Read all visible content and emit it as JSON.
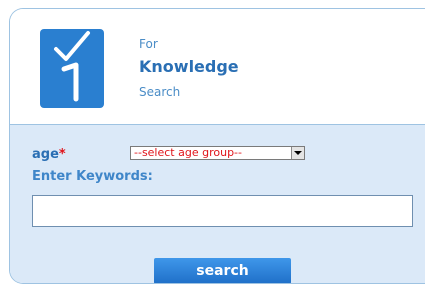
{
  "brand": {
    "logo_icon": "check-one-icon",
    "line1": "For",
    "line2": "Knowledge",
    "line3": "Search"
  },
  "form": {
    "age_label": "age",
    "required_mark": "*",
    "age_select_value": "--select age group--",
    "keywords_label": "Enter Keywords:",
    "keywords_value": "",
    "search_label": "search"
  },
  "colors": {
    "accent": "#2a7fd0",
    "form_bg": "#dbe9f8",
    "required": "#e0141a"
  }
}
